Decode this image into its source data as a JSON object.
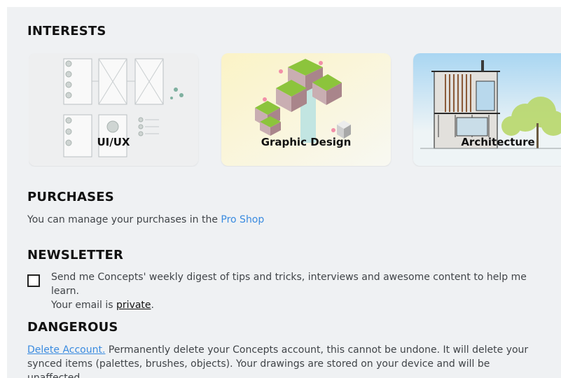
{
  "interests": {
    "title": "INTERESTS",
    "cards": [
      {
        "label": "UI/UX"
      },
      {
        "label": "Graphic Design"
      },
      {
        "label": "Architecture"
      }
    ]
  },
  "purchases": {
    "title": "PURCHASES",
    "text": "You can manage your purchases in the ",
    "link": "Pro Shop"
  },
  "newsletter": {
    "title": "NEWSLETTER",
    "checked": false,
    "text_line1": "Send me Concepts' weekly digest of tips and tricks, interviews and awesome content to help me learn.",
    "text_prefix": "Your email is ",
    "link": "private",
    "text_suffix": "."
  },
  "dangerous": {
    "title": "DANGEROUS",
    "link": "Delete Account.",
    "text": " Permanently delete your Concepts account, this cannot be undone. It will delete your synced items (palettes, brushes, objects). Your drawings are stored on your device and will be unaffected."
  },
  "colors": {
    "panel_bg": "#eff1f3",
    "link": "#3a8be0",
    "heading": "#111111",
    "body_text": "#404448"
  }
}
